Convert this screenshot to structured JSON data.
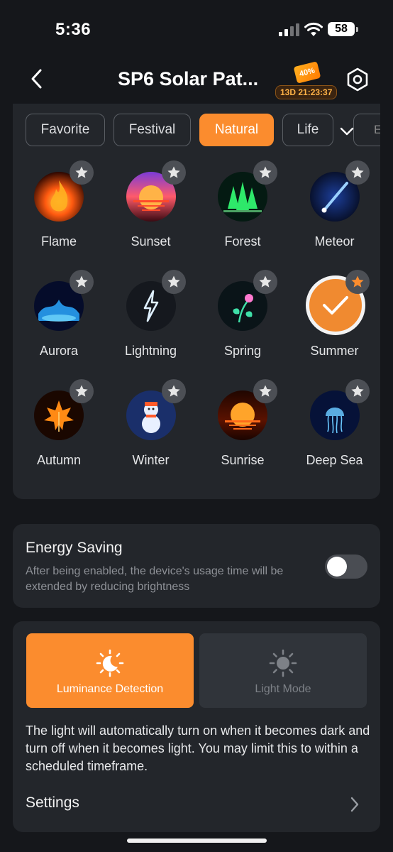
{
  "status_bar": {
    "time": "5:36",
    "battery": "58"
  },
  "header": {
    "title": "SP6 Solar Pat...",
    "promo_badge": "40%",
    "promo_timer": "13D 21:23:37"
  },
  "tabs": [
    {
      "label": "Favorite",
      "active": false
    },
    {
      "label": "Festival",
      "active": false
    },
    {
      "label": "Natural",
      "active": true
    },
    {
      "label": "Life",
      "active": false
    },
    {
      "label": "En",
      "active": false
    }
  ],
  "scenes": [
    {
      "label": "Flame",
      "icon": "flame-icon",
      "favorite": false
    },
    {
      "label": "Sunset",
      "icon": "sunset-icon",
      "favorite": false
    },
    {
      "label": "Forest",
      "icon": "forest-icon",
      "favorite": false
    },
    {
      "label": "Meteor",
      "icon": "meteor-icon",
      "favorite": false
    },
    {
      "label": "Aurora",
      "icon": "aurora-icon",
      "favorite": false
    },
    {
      "label": "Lightning",
      "icon": "lightning-icon",
      "favorite": false
    },
    {
      "label": "Spring",
      "icon": "spring-icon",
      "favorite": false
    },
    {
      "label": "Summer",
      "icon": "summer-icon",
      "favorite": true,
      "selected": true
    },
    {
      "label": "Autumn",
      "icon": "autumn-icon",
      "favorite": false
    },
    {
      "label": "Winter",
      "icon": "winter-icon",
      "favorite": false
    },
    {
      "label": "Sunrise",
      "icon": "sunrise-icon",
      "favorite": false
    },
    {
      "label": "Deep Sea",
      "icon": "deep-sea-icon",
      "favorite": false
    }
  ],
  "energy_saving": {
    "title": "Energy Saving",
    "description": "After being enabled, the device's usage time will be extended by reducing brightness",
    "enabled": false
  },
  "modes": {
    "luminance_label": "Luminance Detection",
    "light_mode_label": "Light Mode",
    "selected": "Luminance Detection",
    "description": "The light will automatically turn on when it becomes dark and turn off when it becomes light. You may limit this to within a scheduled timeframe.",
    "settings_label": "Settings"
  },
  "colors": {
    "accent": "#fb8c2e",
    "background": "#15171b",
    "card": "#23262b"
  }
}
